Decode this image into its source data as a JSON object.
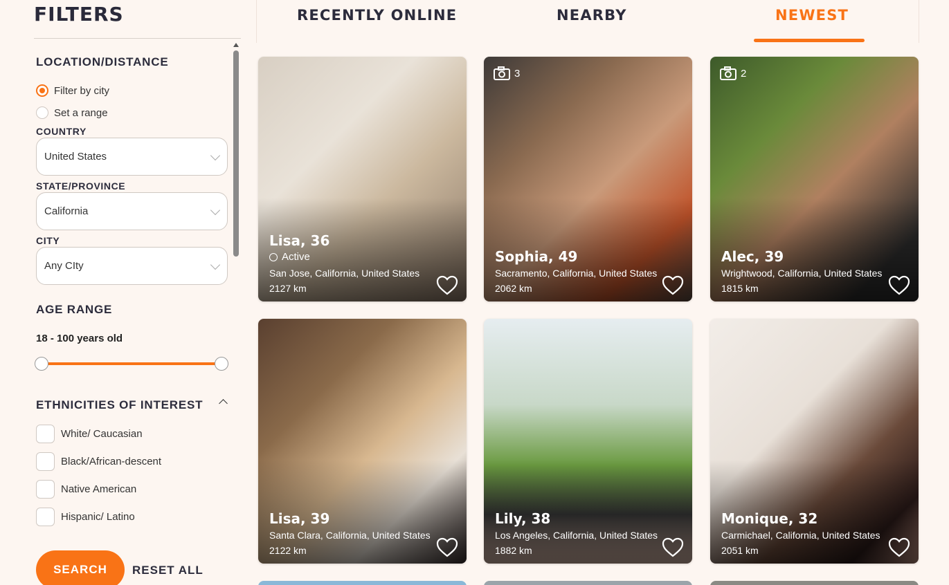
{
  "sidebar": {
    "title": "FILTERS",
    "location_section": {
      "title": "LOCATION/DISTANCE",
      "radios": [
        {
          "label": "Filter by city",
          "checked": true
        },
        {
          "label": "Set a range",
          "checked": false
        }
      ],
      "country_label": "COUNTRY",
      "country_value": "United States",
      "state_label": "STATE/PROVINCE",
      "state_value": "California",
      "city_label": "CITY",
      "city_value": "Any CIty"
    },
    "age_section": {
      "title": "AGE RANGE",
      "value": "18 - 100 years old",
      "min": 18,
      "max": 100
    },
    "ethnicity_section": {
      "title": "ETHNICITIES OF INTEREST",
      "options": [
        "White/ Caucasian",
        "Black/African-descent",
        "Native American",
        "Hispanic/ Latino"
      ]
    },
    "search_label": "SEARCH",
    "reset_label": "RESET ALL"
  },
  "tabs": [
    {
      "label": "RECENTLY ONLINE",
      "active": false
    },
    {
      "label": "NEARBY",
      "active": false
    },
    {
      "label": "NEWEST",
      "active": true
    }
  ],
  "profiles": [
    {
      "name": "Lisa, 36",
      "status": "Active",
      "location": "San Jose, California, United States",
      "distance": "2127 km",
      "photo_count": ""
    },
    {
      "name": "Sophia, 49",
      "status": "",
      "location": "Sacramento, California, United States",
      "distance": "2062 km",
      "photo_count": "3"
    },
    {
      "name": "Alec, 39",
      "status": "",
      "location": "Wrightwood, California, United States",
      "distance": "1815 km",
      "photo_count": "2"
    },
    {
      "name": "Lisa, 39",
      "status": "",
      "location": "Santa Clara, California, United States",
      "distance": "2122 km",
      "photo_count": ""
    },
    {
      "name": "Lily, 38",
      "status": "",
      "location": "Los Angeles, California, United States",
      "distance": "1882 km",
      "photo_count": ""
    },
    {
      "name": "Monique, 32",
      "status": "",
      "location": "Carmichael, California, United States",
      "distance": "2051 km",
      "photo_count": ""
    }
  ],
  "colors": {
    "accent": "#f97316",
    "background": "#fdf6f1",
    "text": "#2c2c3c"
  }
}
